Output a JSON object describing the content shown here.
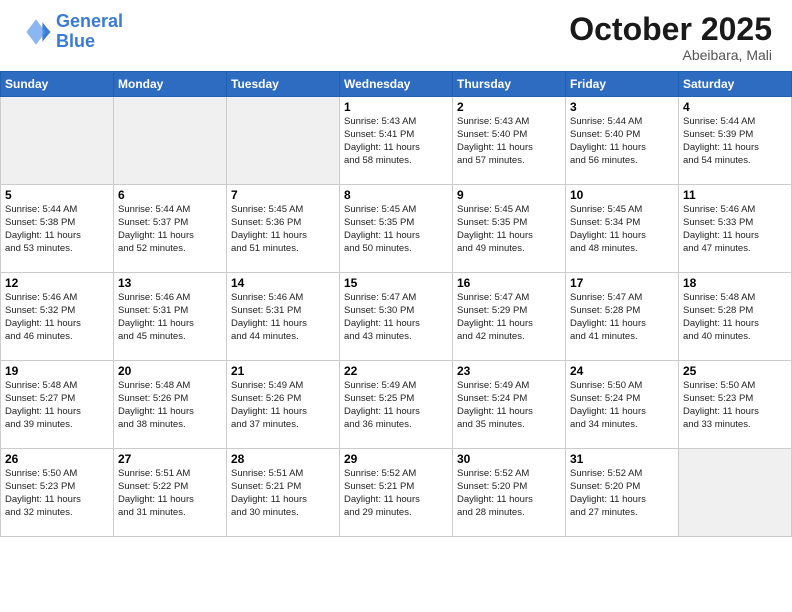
{
  "header": {
    "logo_line1": "General",
    "logo_line2": "Blue",
    "month": "October 2025",
    "location": "Abeibara, Mali"
  },
  "weekdays": [
    "Sunday",
    "Monday",
    "Tuesday",
    "Wednesday",
    "Thursday",
    "Friday",
    "Saturday"
  ],
  "weeks": [
    [
      {
        "day": "",
        "info": ""
      },
      {
        "day": "",
        "info": ""
      },
      {
        "day": "",
        "info": ""
      },
      {
        "day": "1",
        "info": "Sunrise: 5:43 AM\nSunset: 5:41 PM\nDaylight: 11 hours\nand 58 minutes."
      },
      {
        "day": "2",
        "info": "Sunrise: 5:43 AM\nSunset: 5:40 PM\nDaylight: 11 hours\nand 57 minutes."
      },
      {
        "day": "3",
        "info": "Sunrise: 5:44 AM\nSunset: 5:40 PM\nDaylight: 11 hours\nand 56 minutes."
      },
      {
        "day": "4",
        "info": "Sunrise: 5:44 AM\nSunset: 5:39 PM\nDaylight: 11 hours\nand 54 minutes."
      }
    ],
    [
      {
        "day": "5",
        "info": "Sunrise: 5:44 AM\nSunset: 5:38 PM\nDaylight: 11 hours\nand 53 minutes."
      },
      {
        "day": "6",
        "info": "Sunrise: 5:44 AM\nSunset: 5:37 PM\nDaylight: 11 hours\nand 52 minutes."
      },
      {
        "day": "7",
        "info": "Sunrise: 5:45 AM\nSunset: 5:36 PM\nDaylight: 11 hours\nand 51 minutes."
      },
      {
        "day": "8",
        "info": "Sunrise: 5:45 AM\nSunset: 5:35 PM\nDaylight: 11 hours\nand 50 minutes."
      },
      {
        "day": "9",
        "info": "Sunrise: 5:45 AM\nSunset: 5:35 PM\nDaylight: 11 hours\nand 49 minutes."
      },
      {
        "day": "10",
        "info": "Sunrise: 5:45 AM\nSunset: 5:34 PM\nDaylight: 11 hours\nand 48 minutes."
      },
      {
        "day": "11",
        "info": "Sunrise: 5:46 AM\nSunset: 5:33 PM\nDaylight: 11 hours\nand 47 minutes."
      }
    ],
    [
      {
        "day": "12",
        "info": "Sunrise: 5:46 AM\nSunset: 5:32 PM\nDaylight: 11 hours\nand 46 minutes."
      },
      {
        "day": "13",
        "info": "Sunrise: 5:46 AM\nSunset: 5:31 PM\nDaylight: 11 hours\nand 45 minutes."
      },
      {
        "day": "14",
        "info": "Sunrise: 5:46 AM\nSunset: 5:31 PM\nDaylight: 11 hours\nand 44 minutes."
      },
      {
        "day": "15",
        "info": "Sunrise: 5:47 AM\nSunset: 5:30 PM\nDaylight: 11 hours\nand 43 minutes."
      },
      {
        "day": "16",
        "info": "Sunrise: 5:47 AM\nSunset: 5:29 PM\nDaylight: 11 hours\nand 42 minutes."
      },
      {
        "day": "17",
        "info": "Sunrise: 5:47 AM\nSunset: 5:28 PM\nDaylight: 11 hours\nand 41 minutes."
      },
      {
        "day": "18",
        "info": "Sunrise: 5:48 AM\nSunset: 5:28 PM\nDaylight: 11 hours\nand 40 minutes."
      }
    ],
    [
      {
        "day": "19",
        "info": "Sunrise: 5:48 AM\nSunset: 5:27 PM\nDaylight: 11 hours\nand 39 minutes."
      },
      {
        "day": "20",
        "info": "Sunrise: 5:48 AM\nSunset: 5:26 PM\nDaylight: 11 hours\nand 38 minutes."
      },
      {
        "day": "21",
        "info": "Sunrise: 5:49 AM\nSunset: 5:26 PM\nDaylight: 11 hours\nand 37 minutes."
      },
      {
        "day": "22",
        "info": "Sunrise: 5:49 AM\nSunset: 5:25 PM\nDaylight: 11 hours\nand 36 minutes."
      },
      {
        "day": "23",
        "info": "Sunrise: 5:49 AM\nSunset: 5:24 PM\nDaylight: 11 hours\nand 35 minutes."
      },
      {
        "day": "24",
        "info": "Sunrise: 5:50 AM\nSunset: 5:24 PM\nDaylight: 11 hours\nand 34 minutes."
      },
      {
        "day": "25",
        "info": "Sunrise: 5:50 AM\nSunset: 5:23 PM\nDaylight: 11 hours\nand 33 minutes."
      }
    ],
    [
      {
        "day": "26",
        "info": "Sunrise: 5:50 AM\nSunset: 5:23 PM\nDaylight: 11 hours\nand 32 minutes."
      },
      {
        "day": "27",
        "info": "Sunrise: 5:51 AM\nSunset: 5:22 PM\nDaylight: 11 hours\nand 31 minutes."
      },
      {
        "day": "28",
        "info": "Sunrise: 5:51 AM\nSunset: 5:21 PM\nDaylight: 11 hours\nand 30 minutes."
      },
      {
        "day": "29",
        "info": "Sunrise: 5:52 AM\nSunset: 5:21 PM\nDaylight: 11 hours\nand 29 minutes."
      },
      {
        "day": "30",
        "info": "Sunrise: 5:52 AM\nSunset: 5:20 PM\nDaylight: 11 hours\nand 28 minutes."
      },
      {
        "day": "31",
        "info": "Sunrise: 5:52 AM\nSunset: 5:20 PM\nDaylight: 11 hours\nand 27 minutes."
      },
      {
        "day": "",
        "info": ""
      }
    ]
  ]
}
